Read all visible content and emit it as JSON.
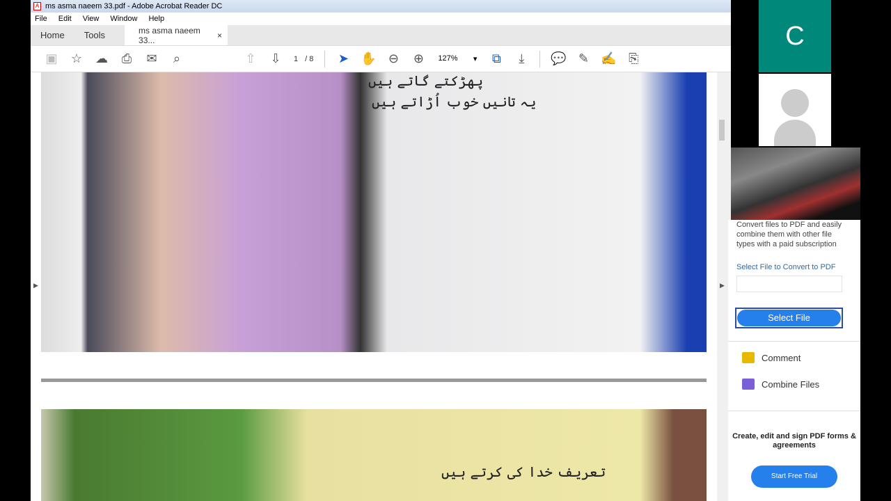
{
  "window": {
    "title": "ms asma naeem 33.pdf - Adobe Acrobat Reader DC"
  },
  "menu": [
    "File",
    "Edit",
    "View",
    "Window",
    "Help"
  ],
  "tabs": {
    "home": "Home",
    "tools": "Tools",
    "doc": "ms asma naeem 33...",
    "close": "×"
  },
  "toolbar": {
    "page_current": "1",
    "page_total": "/ 8",
    "zoom": "127%"
  },
  "page_text": {
    "line1": "پھڑکتے گاتے ہیں",
    "line2": "یہ تانیں خوب اُڑاتے ہیں",
    "line3": "تعریف خدا کی کرتے ہیں"
  },
  "sidebar": {
    "desc": "Convert files to PDF and easily combine them with other file types with a paid subscription",
    "link": "Select File to Convert to PDF",
    "select_btn": "Select File",
    "tools": [
      "Comment",
      "Combine Files"
    ],
    "promo": "Create, edit and sign PDF forms & agreements",
    "trial_btn": "Start Free Trial"
  },
  "video": {
    "participant_initial": "C"
  }
}
